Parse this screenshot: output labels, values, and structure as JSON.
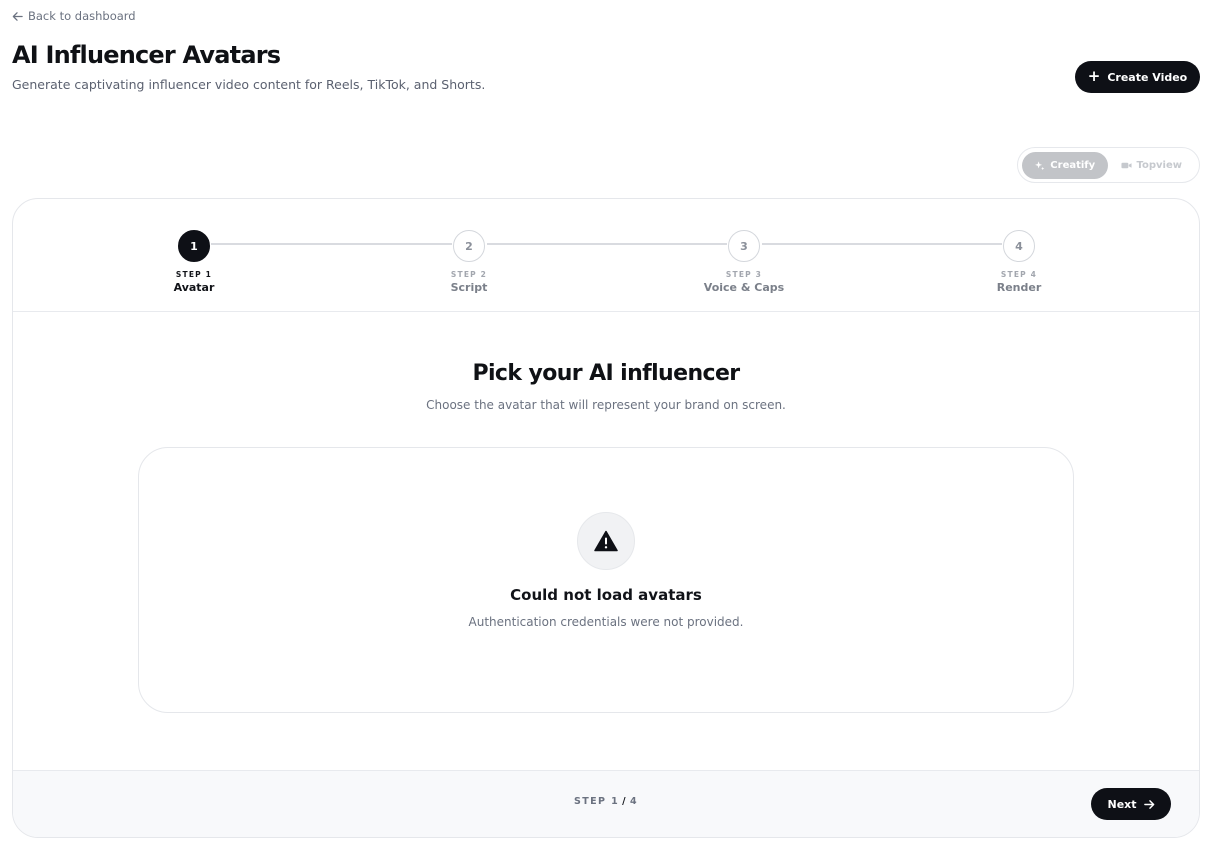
{
  "header": {
    "back_label": "Back to dashboard",
    "title": "AI Influencer Avatars",
    "subtitle": "Generate captivating influencer video content for Reels, TikTok, and Shorts.",
    "create_button_label": "Create Video"
  },
  "provider_toggle": {
    "options": [
      {
        "label": "Creatify",
        "icon": "sparkle-icon",
        "selected": true
      },
      {
        "label": "Topview",
        "icon": "video-camera-icon",
        "selected": false
      }
    ]
  },
  "stepper": {
    "steps": [
      {
        "number": "1",
        "caption": "STEP 1",
        "name": "Avatar",
        "active": true
      },
      {
        "number": "2",
        "caption": "STEP 2",
        "name": "Script",
        "active": false
      },
      {
        "number": "3",
        "caption": "STEP 3",
        "name": "Voice & Caps",
        "active": false
      },
      {
        "number": "4",
        "caption": "STEP 4",
        "name": "Render",
        "active": false
      }
    ]
  },
  "body": {
    "title": "Pick your AI influencer",
    "subtitle": "Choose the avatar that will represent your brand on screen.",
    "error": {
      "icon": "warning-icon",
      "title": "Could not load avatars",
      "message": "Authentication credentials were not provided."
    }
  },
  "footer": {
    "step_label": "STEP",
    "current_step": "1",
    "total_steps": "4",
    "next_label": "Next"
  },
  "colors": {
    "primary": "#0e1016",
    "border": "#e5e7eb",
    "muted_text": "#6b7280",
    "toggle_active": "#c2c4c8"
  }
}
